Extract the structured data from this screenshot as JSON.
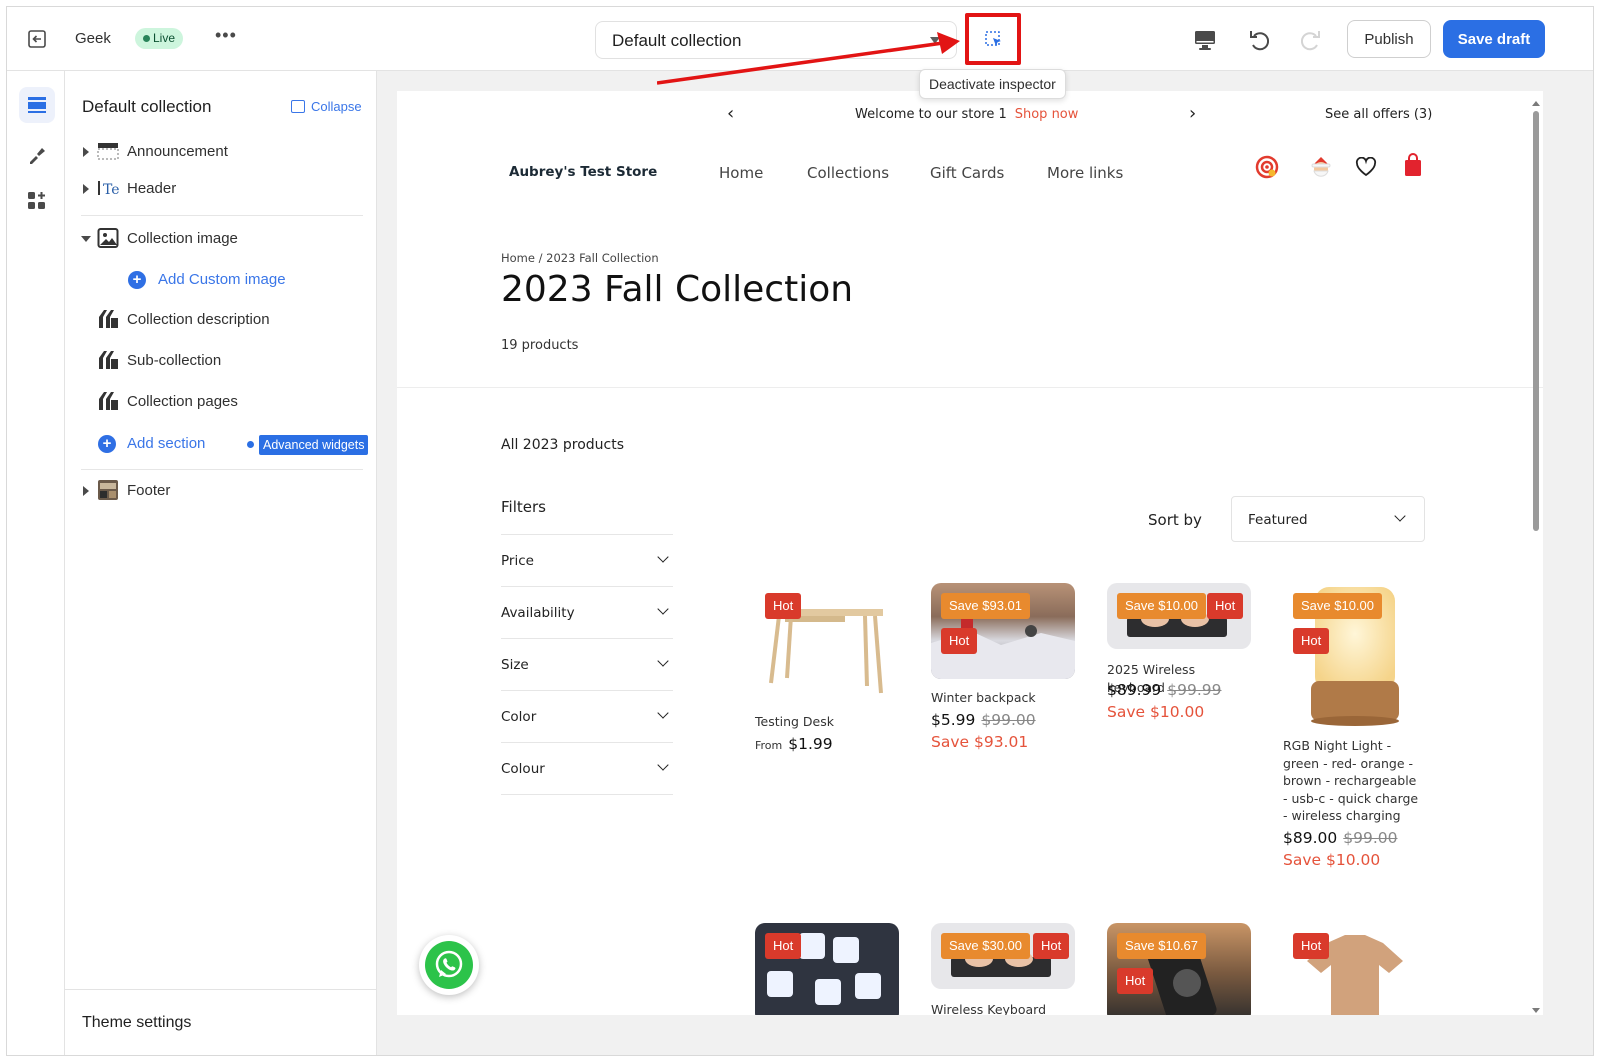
{
  "topbar": {
    "store_name": "Geek",
    "live_label": "Live",
    "more_label": "•••",
    "template_select": "Default collection",
    "tooltip": "Deactivate inspector",
    "publish_label": "Publish",
    "save_label": "Save draft",
    "icons": [
      "exit-icon",
      "inspector-icon",
      "desktop-icon",
      "undo-icon",
      "redo-icon"
    ]
  },
  "sidebar": {
    "title": "Default collection",
    "collapse_label": "Collapse",
    "items": [
      {
        "label": "Announcement",
        "icon": "announcement-icon"
      },
      {
        "label": "Header",
        "icon": "header-icon"
      },
      {
        "label": "Collection image",
        "icon": "image-icon"
      },
      {
        "label": "Add Custom image",
        "icon": "plus-icon"
      },
      {
        "label": "Collection description",
        "icon": "section-icon"
      },
      {
        "label": "Sub-collection",
        "icon": "section-icon"
      },
      {
        "label": "Collection pages",
        "icon": "section-icon"
      },
      {
        "label": "Add section",
        "icon": "plus-icon"
      },
      {
        "label": "Footer",
        "icon": "footer-icon"
      }
    ],
    "advanced_widgets": "Advanced widgets",
    "theme_settings": "Theme settings"
  },
  "store": {
    "announcement": "Welcome to our store 1",
    "shop_now": "Shop now",
    "offers": "See all offers (3)",
    "brand": "Aubrey's Test Store",
    "nav": [
      "Home",
      "Collections",
      "Gift Cards",
      "More links"
    ],
    "breadcrumb": "Home / 2023 Fall Collection",
    "title": "2023 Fall Collection",
    "count": "19 products",
    "all_products": "All 2023 products",
    "filters_title": "Filters",
    "filters": [
      "Price",
      "Availability",
      "Size",
      "Color",
      "Colour"
    ],
    "sort_label": "Sort by",
    "sort_value": "Featured"
  },
  "products": [
    {
      "name": "Testing Desk",
      "from": "From",
      "price": "$1.99",
      "compare": "",
      "save": "",
      "badges": [
        "Hot"
      ]
    },
    {
      "name": "Winter backpack",
      "price": "$5.99",
      "compare": "$99.00",
      "save": "Save $93.01",
      "badges": [
        "Save $93.01",
        "Hot"
      ]
    },
    {
      "name": "2025 Wireless keyboard",
      "price": "$89.99",
      "compare": "$99.99",
      "save": "Save $10.00",
      "badges": [
        "Save $10.00",
        "Hot"
      ]
    },
    {
      "name": "RGB Night Light - green - red- orange - brown - rechargeable - usb-c - quick charge - wireless charging",
      "price": "$89.00",
      "compare": "$99.00",
      "save": "Save $10.00",
      "badges": [
        "Save $10.00",
        "Hot"
      ]
    },
    {
      "name": "",
      "badges": [
        "Hot"
      ]
    },
    {
      "name": "Wireless Keyboard",
      "badges": [
        "Save $30.00",
        "Hot"
      ]
    },
    {
      "name": "",
      "badges": [
        "Save $10.67",
        "Hot"
      ]
    },
    {
      "name": "",
      "badges": [
        "Hot"
      ]
    }
  ],
  "colors": {
    "accent": "#2b6fe4",
    "highlight": "#e21414",
    "sale": "#e5533b",
    "badge_save": "#e88a2e",
    "badge_hot": "#d93a2b"
  }
}
